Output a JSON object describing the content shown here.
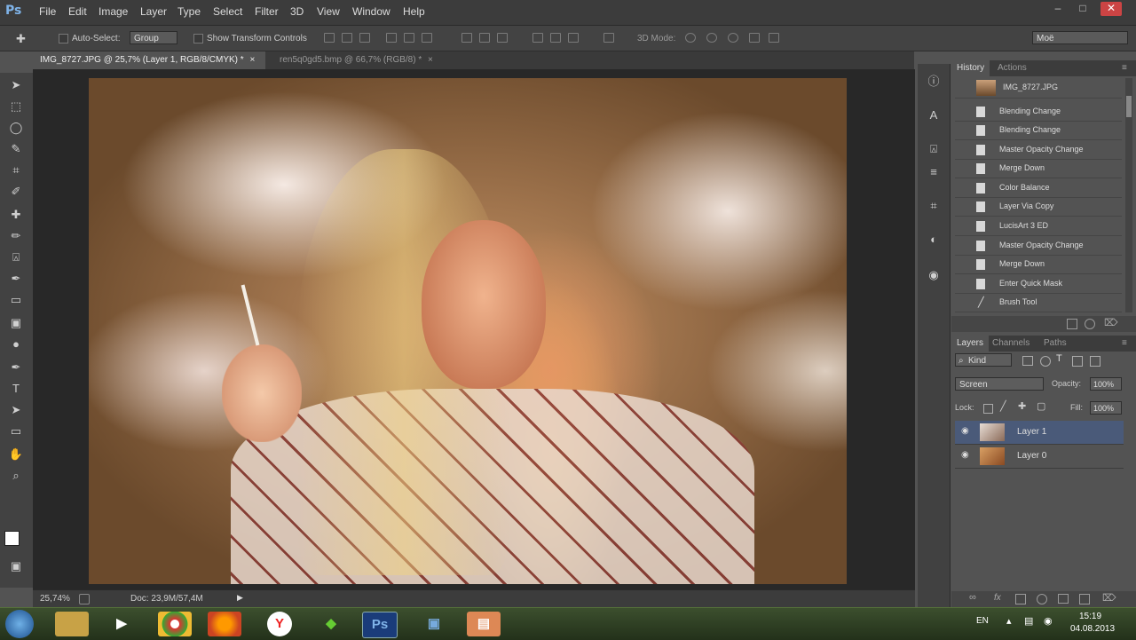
{
  "app": {
    "logo": "Ps"
  },
  "menu": [
    "File",
    "Edit",
    "Image",
    "Layer",
    "Type",
    "Select",
    "Filter",
    "3D",
    "View",
    "Window",
    "Help"
  ],
  "window_controls": [
    "–",
    "□",
    "✕"
  ],
  "options": {
    "auto_select_label": "Auto-Select:",
    "auto_select_value": "Group",
    "show_transform_label": "Show Transform Controls",
    "mode_3d_label": "3D Mode:",
    "workspace": "Моё"
  },
  "tabs": [
    {
      "label": "IMG_8727.JPG @ 25,7% (Layer 1, RGB/8/CMYK) *",
      "close": "×"
    },
    {
      "label": "ren5q0gd5.bmp @ 66,7% (RGB/8) *",
      "close": "×"
    }
  ],
  "status": {
    "zoom": "25,74%",
    "doc": "Doc: 23,9M/57,4M",
    "arrow": "▶"
  },
  "history": {
    "tabs": [
      "History",
      "Actions"
    ],
    "snapshot": "IMG_8727.JPG",
    "items": [
      "Blending Change",
      "Blending Change",
      "Master Opacity Change",
      "Merge Down",
      "Color Balance",
      "Layer Via Copy",
      "LucisArt 3 ED",
      "Master Opacity Change",
      "Merge Down",
      "Enter Quick Mask",
      "Brush Tool"
    ]
  },
  "layers": {
    "tabs": [
      "Layers",
      "Channels",
      "Paths"
    ],
    "kind": "Kind",
    "blend_mode": "Screen",
    "opacity_label": "Opacity:",
    "opacity_value": "100%",
    "lock_label": "Lock:",
    "fill_label": "Fill:",
    "fill_value": "100%",
    "items": [
      "Layer 1",
      "Layer 0"
    ]
  },
  "taskbar": {
    "ps_label": "Ps",
    "lang": "EN",
    "time": "15:19",
    "date": "04.08.2013"
  }
}
